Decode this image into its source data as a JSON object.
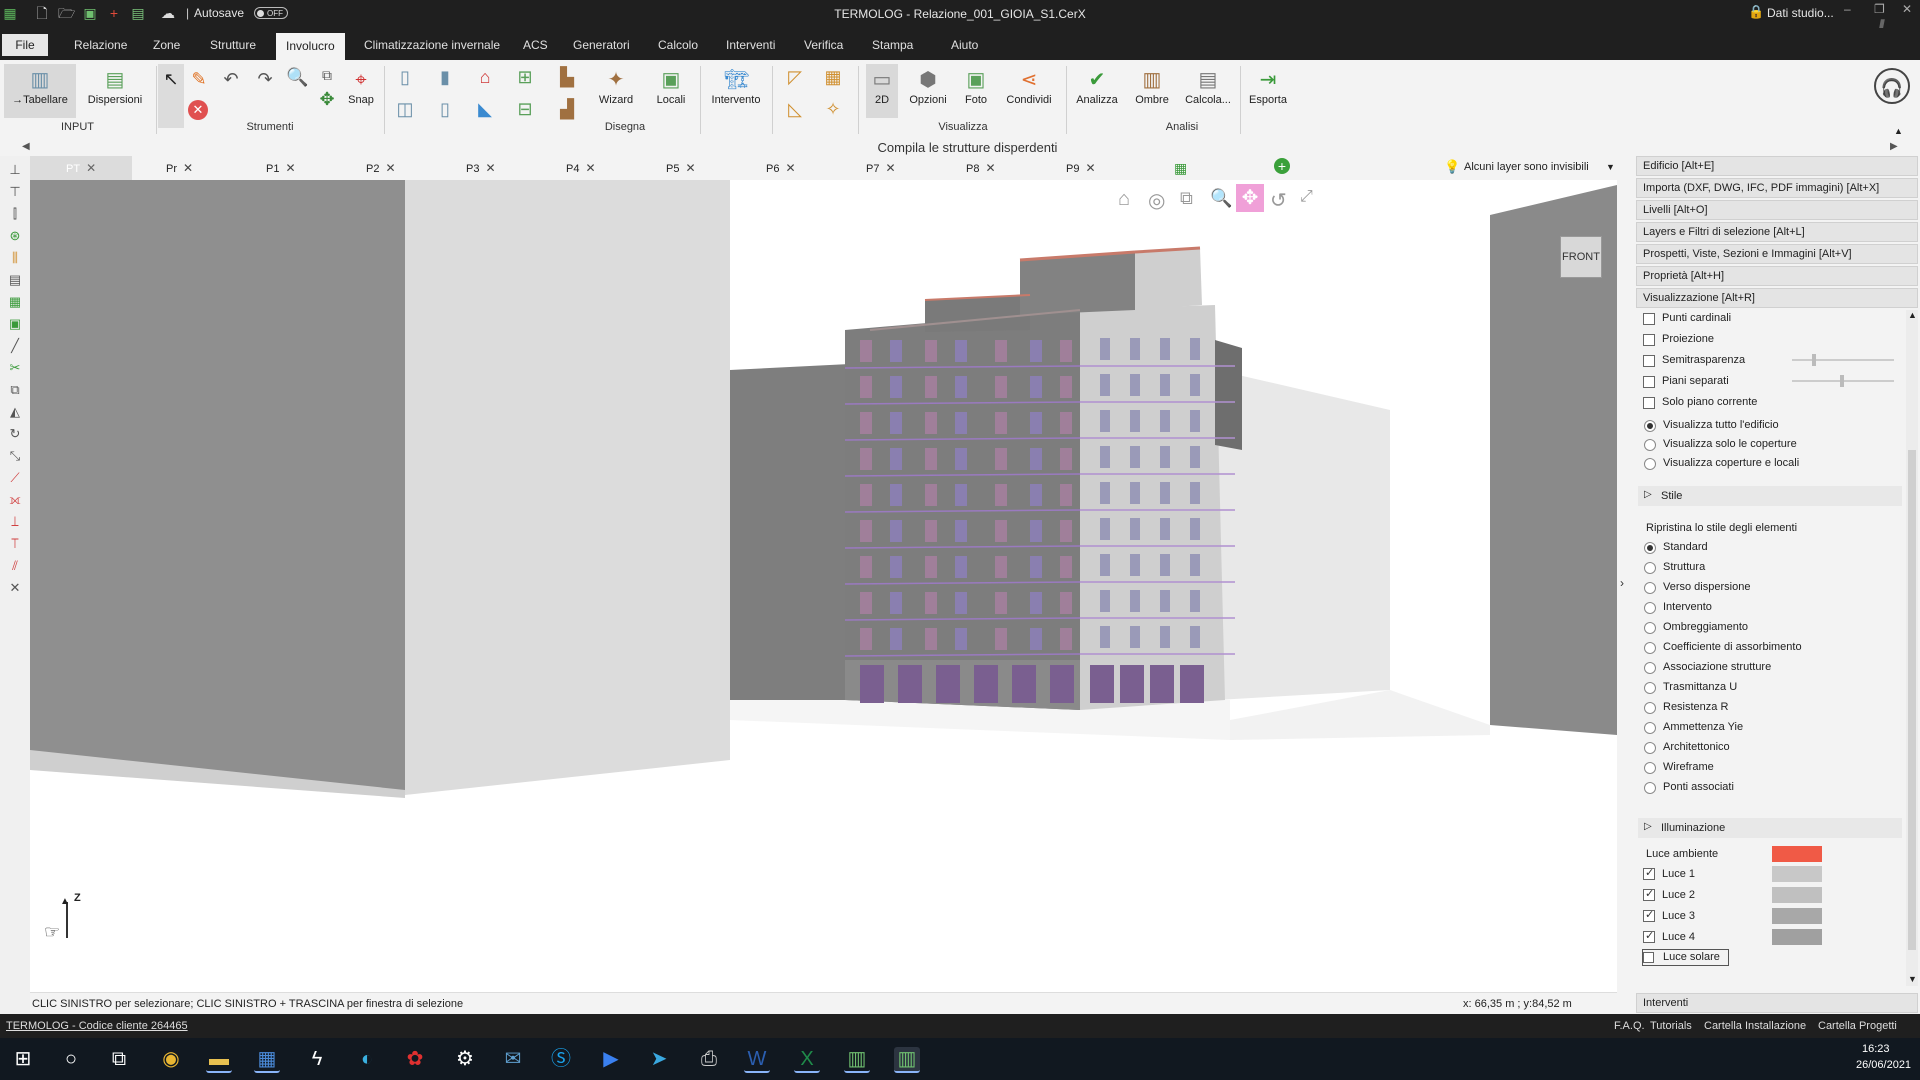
{
  "titlebar": {
    "title": "TERMOLOG - Relazione_001_GIOIA_S1.CerX",
    "autosave_label": "Autosave",
    "autosave_state": "OFF",
    "account": "Dati studio..."
  },
  "menu": {
    "items": [
      "File",
      "Relazione",
      "Zone",
      "Strutture",
      "Involucro",
      "Climatizzazione invernale",
      "ACS",
      "Generatori",
      "Calcolo",
      "Interventi",
      "Verifica",
      "Stampa",
      "Aiuto"
    ],
    "active": "Involucro"
  },
  "ribbon": {
    "input": {
      "tabellare": "→Tabellare",
      "dispersioni": "Dispersioni",
      "group": "INPUT"
    },
    "strumenti": {
      "snap": "Snap",
      "group": "Strumenti"
    },
    "disegna": {
      "wizard": "Wizard",
      "locali": "Locali",
      "intervento": "Intervento",
      "group": "Disegna"
    },
    "visualizza": {
      "b2d": "2D",
      "opzioni": "Opzioni",
      "foto": "Foto",
      "condividi": "Condividi",
      "group": "Visualizza"
    },
    "analisi": {
      "analizza": "Analizza",
      "ombre": "Ombre",
      "calcola": "Calcola...",
      "esporta": "Esporta",
      "group": "Analisi"
    }
  },
  "hint": "Compila le strutture disperdenti",
  "tabs": [
    "PT",
    "Pr",
    "P1",
    "P2",
    "P3",
    "P4",
    "P5",
    "P6",
    "P7",
    "P8",
    "P9"
  ],
  "layers_notice": "Alcuni layer sono invisibili",
  "view": {
    "cube_label": "FRONT",
    "axis_label": "Z"
  },
  "status": {
    "message": "CLIC SINISTRO per selezionare; CLIC SINISTRO + TRASCINA per finestra di selezione",
    "coords": "x: 66,35 m ; y:84,52 m"
  },
  "panel": {
    "headers": [
      "Edificio [Alt+E]",
      "Importa (DXF, DWG, IFC, PDF immagini) [Alt+X]",
      "Livelli [Alt+O]",
      "Layers e Filtri di selezione [Alt+L]",
      "Prospetti, Viste, Sezioni e Immagini [Alt+V]",
      "Proprietà [Alt+H]",
      "Visualizzazione [Alt+R]"
    ],
    "checks": [
      "Punti cardinali",
      "Proiezione",
      "Semitrasparenza",
      "Piani separati",
      "Solo piano corrente"
    ],
    "view_radios": [
      "Visualizza tutto l'edificio",
      "Visualizza solo le coperture",
      "Visualizza coperture e locali"
    ],
    "stile_title": "Stile",
    "stile_reset": "Ripristina lo stile degli elementi",
    "style_radios": [
      "Standard",
      "Struttura",
      "Verso dispersione",
      "Intervento",
      "Ombreggiamento",
      "Coefficiente di assorbimento",
      "Associazione strutture",
      "Trasmittanza U",
      "Resistenza R",
      "Ammettenza Yie",
      "Architettonico",
      "Wireframe",
      "Ponti associati"
    ],
    "illum_title": "Illuminazione",
    "luce_ambiente": "Luce ambiente",
    "lights": [
      "Luce 1",
      "Luce 2",
      "Luce 3",
      "Luce 4"
    ],
    "luce_solare": "Luce solare",
    "interventi": "Interventi",
    "colors": {
      "ambiente": "#f05a46",
      "l1": "#c8c8c8",
      "l2": "#c0c0c0",
      "l3": "#a8a8a8",
      "l4": "#a0a0a0"
    }
  },
  "footer": {
    "client": "TERMOLOG - Codice cliente 264465",
    "links": [
      "F.A.Q.",
      "Tutorials",
      "Cartella Installazione",
      "Cartella Progetti"
    ]
  },
  "clock": {
    "time": "16:23",
    "date": "26/06/2021"
  }
}
